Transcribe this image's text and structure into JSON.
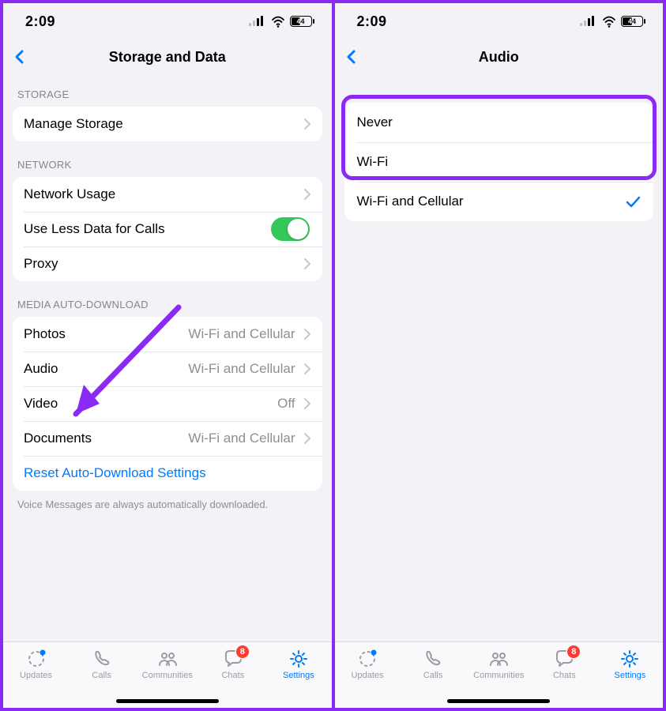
{
  "statusbar": {
    "time": "2:09",
    "battery_pct": "44"
  },
  "screen_left": {
    "title": "Storage and Data",
    "sections": {
      "storage": {
        "header": "STORAGE",
        "manage": "Manage Storage"
      },
      "network": {
        "header": "NETWORK",
        "usage": "Network Usage",
        "less_data": "Use Less Data for Calls",
        "proxy": "Proxy"
      },
      "media": {
        "header": "MEDIA AUTO-DOWNLOAD",
        "photos": {
          "label": "Photos",
          "value": "Wi-Fi and Cellular"
        },
        "audio": {
          "label": "Audio",
          "value": "Wi-Fi and Cellular"
        },
        "video": {
          "label": "Video",
          "value": "Off"
        },
        "docs": {
          "label": "Documents",
          "value": "Wi-Fi and Cellular"
        },
        "reset": "Reset Auto-Download Settings",
        "footer": "Voice Messages are always automatically downloaded."
      }
    }
  },
  "screen_right": {
    "title": "Audio",
    "options": {
      "never": "Never",
      "wifi": "Wi-Fi",
      "wifi_cell": "Wi-Fi and Cellular"
    }
  },
  "tabs": {
    "updates": "Updates",
    "calls": "Calls",
    "communities": "Communities",
    "chats": "Chats",
    "chats_badge": "8",
    "settings": "Settings"
  },
  "colors": {
    "accent": "#007aff",
    "annotate": "#8b29f5"
  }
}
